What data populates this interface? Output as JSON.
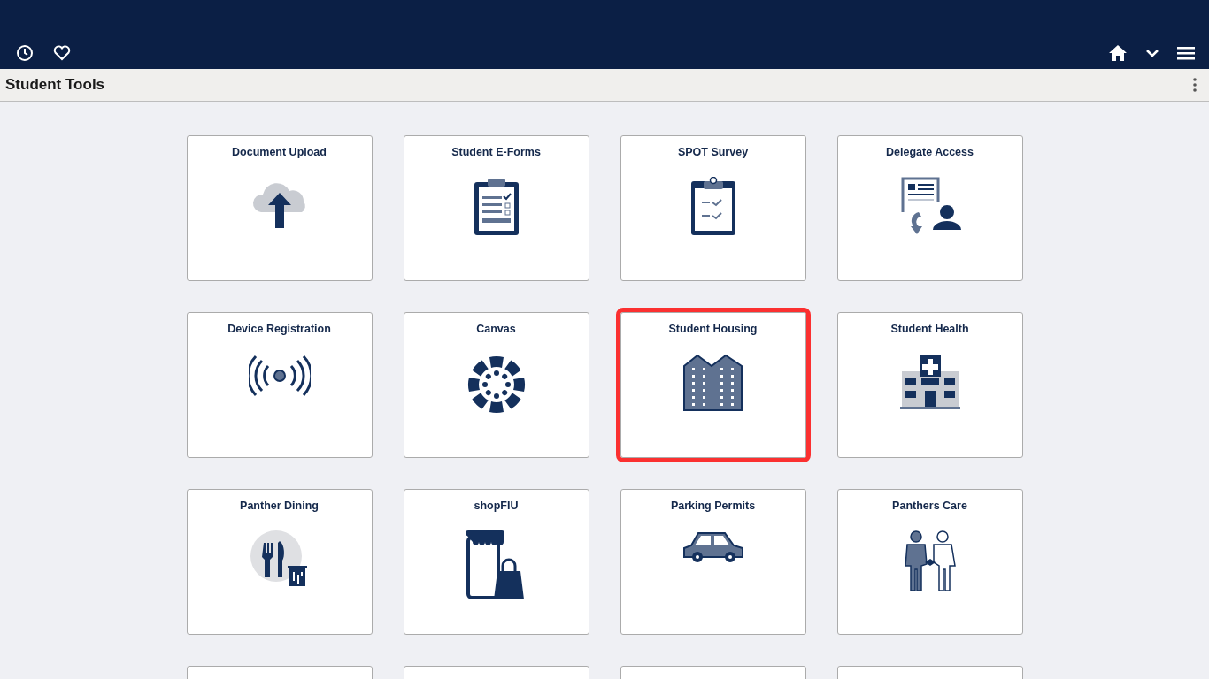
{
  "page_title": "Student Tools",
  "tiles": [
    {
      "title": "Document Upload",
      "highlighted": false
    },
    {
      "title": "Student E-Forms",
      "highlighted": false
    },
    {
      "title": "SPOT Survey",
      "highlighted": false
    },
    {
      "title": "Delegate Access",
      "highlighted": false
    },
    {
      "title": "Device Registration",
      "highlighted": false
    },
    {
      "title": "Canvas",
      "highlighted": false
    },
    {
      "title": "Student Housing",
      "highlighted": true
    },
    {
      "title": "Student Health",
      "highlighted": false
    },
    {
      "title": "Panther Dining",
      "highlighted": false
    },
    {
      "title": "shopFIU",
      "highlighted": false
    },
    {
      "title": "Parking Permits",
      "highlighted": false
    },
    {
      "title": "Panthers Care",
      "highlighted": false
    }
  ],
  "partial_tiles": [
    {
      "kind": "tile"
    },
    {
      "kind": "tile"
    },
    {
      "kind": "tile"
    },
    {
      "kind": "tile"
    }
  ]
}
